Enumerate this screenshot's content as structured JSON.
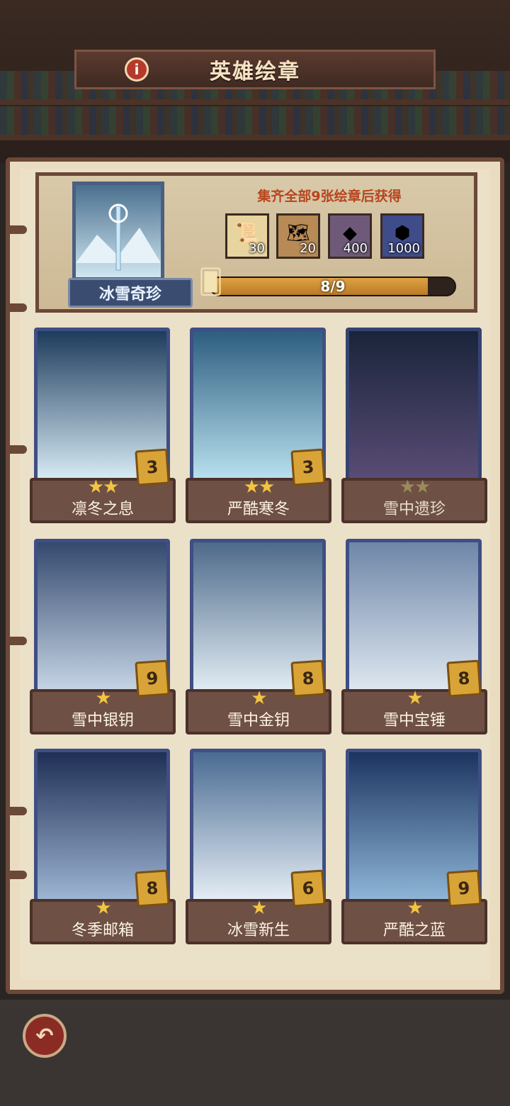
{
  "header": {
    "title": "英雄绘章"
  },
  "collection": {
    "name": "冰雪奇珍",
    "reward_caption": "集齐全部9张绘章后获得",
    "rewards": [
      {
        "icon": "scroll-icon",
        "count": "30"
      },
      {
        "icon": "map-scroll-icon",
        "count": "20"
      },
      {
        "icon": "ore-icon",
        "count": "400"
      },
      {
        "icon": "ore-chest-icon",
        "count": "1000"
      }
    ],
    "progress_text": "8/9",
    "progress_value": 0.889
  },
  "cards": [
    {
      "name": "凛冬之息",
      "count": "3",
      "stars": "★★",
      "owned": true
    },
    {
      "name": "严酷寒冬",
      "count": "3",
      "stars": "★★",
      "owned": true
    },
    {
      "name": "雪中遗珍",
      "count": "",
      "stars": "★★",
      "owned": false
    },
    {
      "name": "雪中银钥",
      "count": "9",
      "stars": "★",
      "owned": true
    },
    {
      "name": "雪中金钥",
      "count": "8",
      "stars": "★",
      "owned": true
    },
    {
      "name": "雪中宝锤",
      "count": "8",
      "stars": "★",
      "owned": true
    },
    {
      "name": "冬季邮箱",
      "count": "8",
      "stars": "★",
      "owned": true
    },
    {
      "name": "冰雪新生",
      "count": "6",
      "stars": "★",
      "owned": true
    },
    {
      "name": "严酷之蓝",
      "count": "9",
      "stars": "★",
      "owned": true
    }
  ]
}
